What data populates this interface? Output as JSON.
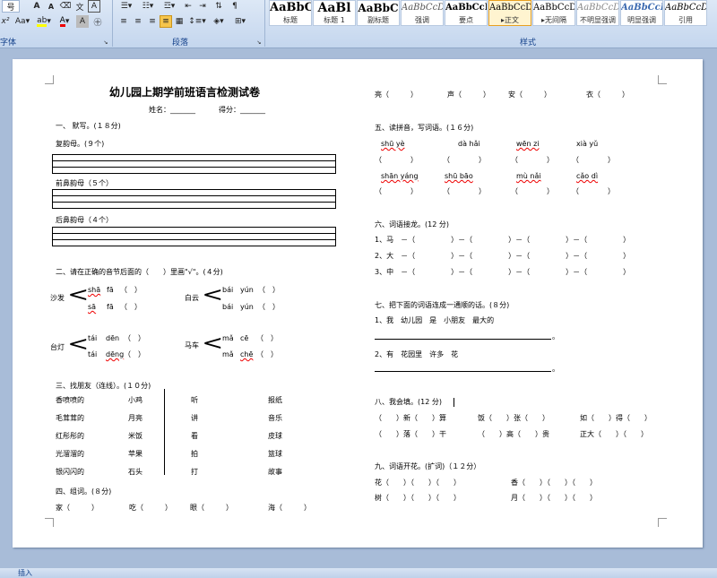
{
  "ribbon": {
    "row1_left": [
      "号",
      "A",
      "A",
      "Aa"
    ],
    "font_group_label": "字体",
    "para_group_label": "段落",
    "styles_group_label": "样式",
    "styles": [
      {
        "sample": "AaBbC",
        "name": "标题"
      },
      {
        "sample": "AaBl",
        "name": "标题 1"
      },
      {
        "sample": "AaBbC",
        "name": "副标题"
      },
      {
        "sample": "AaBbCcDd",
        "name": "强调"
      },
      {
        "sample": "AaBbCcD",
        "name": "要点"
      },
      {
        "sample": "AaBbCcDd",
        "name": "正文"
      },
      {
        "sample": "AaBbCcDd",
        "name": "无间隔"
      },
      {
        "sample": "AaBbCcDd",
        "name": "不明显强调"
      },
      {
        "sample": "AaBbCcDd",
        "name": "明显强调"
      },
      {
        "sample": "AaBbCcDd",
        "name": "引用"
      }
    ]
  },
  "status": {
    "left": "插入"
  },
  "doc": {
    "title": "幼儿园上期学前班语言检测试卷",
    "name_label": "姓名：_______",
    "score_label": "得分：_______",
    "s1": "一、 默写。(１８分)",
    "s1a": "复韵母。(９个)",
    "s1b": "前鼻韵母（５个）",
    "s1c": "后鼻韵母（４个）",
    "s2": "二、请在正确的音节后面的（　　）里画\"√\"。(４分)",
    "s2_items": [
      {
        "word": "沙发",
        "p1": "shā",
        "p1b": "fā",
        "p2": "sā",
        "p2b": "fā"
      },
      {
        "word": "白云",
        "p1": "bái",
        "p1b": "yún",
        "p2": "bái",
        "p2b": "yún"
      },
      {
        "word": "台灯",
        "p1": "tái",
        "p1b": "dēn",
        "p2": "tái",
        "p2b": "dēng"
      },
      {
        "word": "马车",
        "p1": "mǎ",
        "p1b": "cē",
        "p2": "mǎ",
        "p2b": "chē"
      }
    ],
    "paren": "（　）",
    "s3": "三、找朋友（连线）。(１０分)",
    "s3_col1": [
      "香喷喷的",
      "毛茸茸的",
      "红彤彤的",
      "光溜溜的",
      "银闪闪的"
    ],
    "s3_col2": [
      "小鸡",
      "月亮",
      "米饭",
      "苹果",
      "石头"
    ],
    "s3_col3": [
      "听",
      "讲",
      "看",
      "拍",
      "打"
    ],
    "s3_col4": [
      "报纸",
      "音乐",
      "皮球",
      "篮球",
      "故事"
    ],
    "s4": "四、组词。(８分)",
    "s4_row1": [
      "家（　　　）",
      "吃（　　　）",
      "眼（　　　）",
      "海（　　　）"
    ],
    "s4_row2": [
      "亮（　　　）",
      "声（　　　）",
      "安（　　　）",
      "衣（　　　）"
    ],
    "s5": "五、读拼音，写词语。(１６分)",
    "s5_row1": [
      "shū  yè",
      "dà  hǎi",
      "wēn  zi",
      "xià  yǔ"
    ],
    "s5_row2": [
      "shān  yáng",
      "shū  bāo",
      "mù  nǎi",
      "cǎo  dì"
    ],
    "blank_paren": "（　　　　）",
    "s6": "六、词语接龙。(12 分)",
    "s6_items": [
      "1、马　－（　　　　　）－（　　　　　）－（　　　　　）－（　　　　　）",
      "2、大　－（　　　　　）－（　　　　　）－（　　　　　）－（　　　　　）",
      "3、中　－（　　　　　）－（　　　　　）－（　　　　　）－（　　　　　）"
    ],
    "s7": "七、把下面的词语连成一通顺的话。(８分)",
    "s7_1": "1、我　幼儿园　是　小朋友　最大的",
    "s7_2": "2、有　花园里　许多　花",
    "s7_end": "。",
    "s8": "八、我会填。(12 分)",
    "s8_row1": [
      "（　　）新（　　）算",
      "饭（　　）张（　　）",
      "如（　　）得（　　）"
    ],
    "s8_row2": [
      "（　　）落（　　）干",
      "（　　）高（　　）贵",
      "正大（　　）（　　）"
    ],
    "s9": "九、词语开花。(扩词)（１２分）",
    "s9_row1": [
      "花（　　）（　　）（　　）",
      "香（　　）（　　）（　　）"
    ],
    "s9_row2": [
      "树（　　）（　　）（　　）",
      "月（　　）（　　）（　　）"
    ]
  }
}
